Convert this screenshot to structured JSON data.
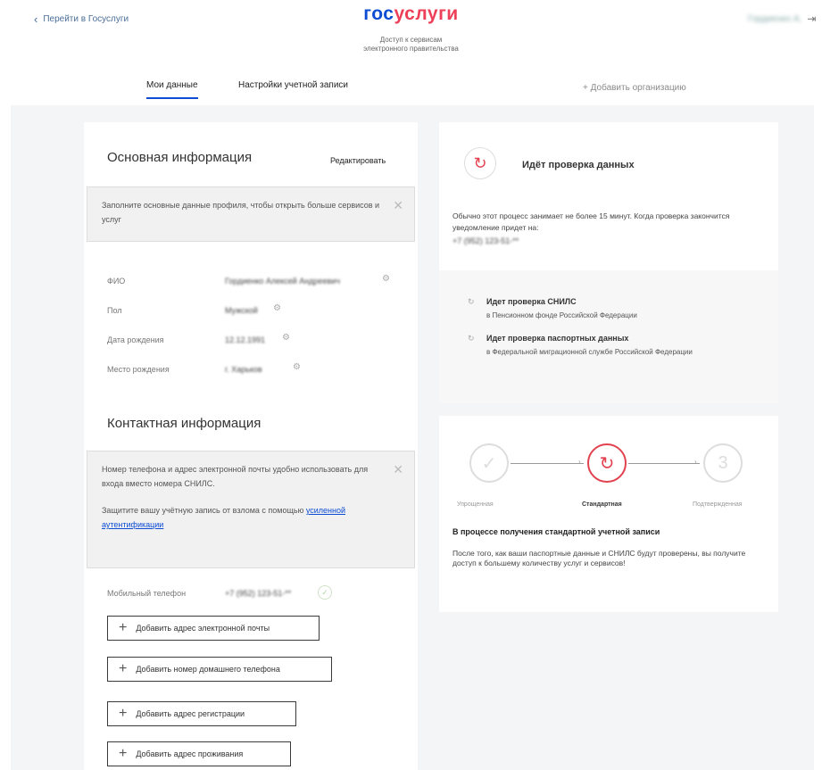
{
  "header": {
    "back_label": "Перейти в Госуслуги",
    "logo_part1": "гос",
    "logo_part2": "услуги",
    "subtitle_line1": "Доступ к сервисам",
    "subtitle_line2": "электронного правительства",
    "user_name": "Гордиенко А."
  },
  "tabs": {
    "my_data": "Мои данные",
    "account_settings": "Настройки учетной записи",
    "add_org": "+ Добавить организацию"
  },
  "basic": {
    "title": "Основная информация",
    "edit_label": "Редактировать",
    "note": "Заполните основные данные профиля, чтобы открыть больше сервисов и услуг",
    "fields": [
      {
        "label": "ФИО",
        "value": "Гордиенко Алексей Андреевич"
      },
      {
        "label": "Пол",
        "value": "Мужской"
      },
      {
        "label": "Дата рождения",
        "value": "12.12.1991"
      },
      {
        "label": "Место рождения",
        "value": "г. Харьков"
      }
    ]
  },
  "contact": {
    "title": "Контактная информация",
    "note_line1": "Номер телефона и адрес электронной почты удобно использовать для входа вместо номера СНИЛС.",
    "note_line2_prefix": "Защитите вашу учётную запись от взлома с помощью",
    "note_link": "усиленной аутентификации",
    "phone_label": "Мобильный телефон",
    "phone_value": "+7 (952) 123-51-**",
    "buttons": [
      "Добавить адрес электронной почты",
      "Добавить номер домашнего телефона",
      "Добавить адрес регистрации",
      "Добавить адрес проживания"
    ]
  },
  "verification": {
    "title": "Идёт проверка данных",
    "desc": "Обычно этот процесс занимает не более 15 минут. Когда проверка закончится уведомление придет на:",
    "phone": "+7 (952) 123-51-**",
    "checks": [
      {
        "title": "Идет проверка СНИЛС",
        "sub": "в Пенсионном фонде Российской Федерации"
      },
      {
        "title": "Идет проверка паспортных данных",
        "sub": "в Федеральной миграционной службе Российской Федерации"
      }
    ]
  },
  "steps": {
    "labels": [
      "Упрощенная",
      "Стандартная",
      "Подтвержденная"
    ],
    "third_num": "3",
    "heading": "В процессе получения стандартной учетной записи",
    "desc": "После того, как ваши паспортные данные и СНИЛС будут проверены, вы получите доступ к большему количеству услуг и сервисов!"
  },
  "colors": {
    "brand_blue": "#0d4cd3",
    "brand_red": "#ee3f58"
  }
}
